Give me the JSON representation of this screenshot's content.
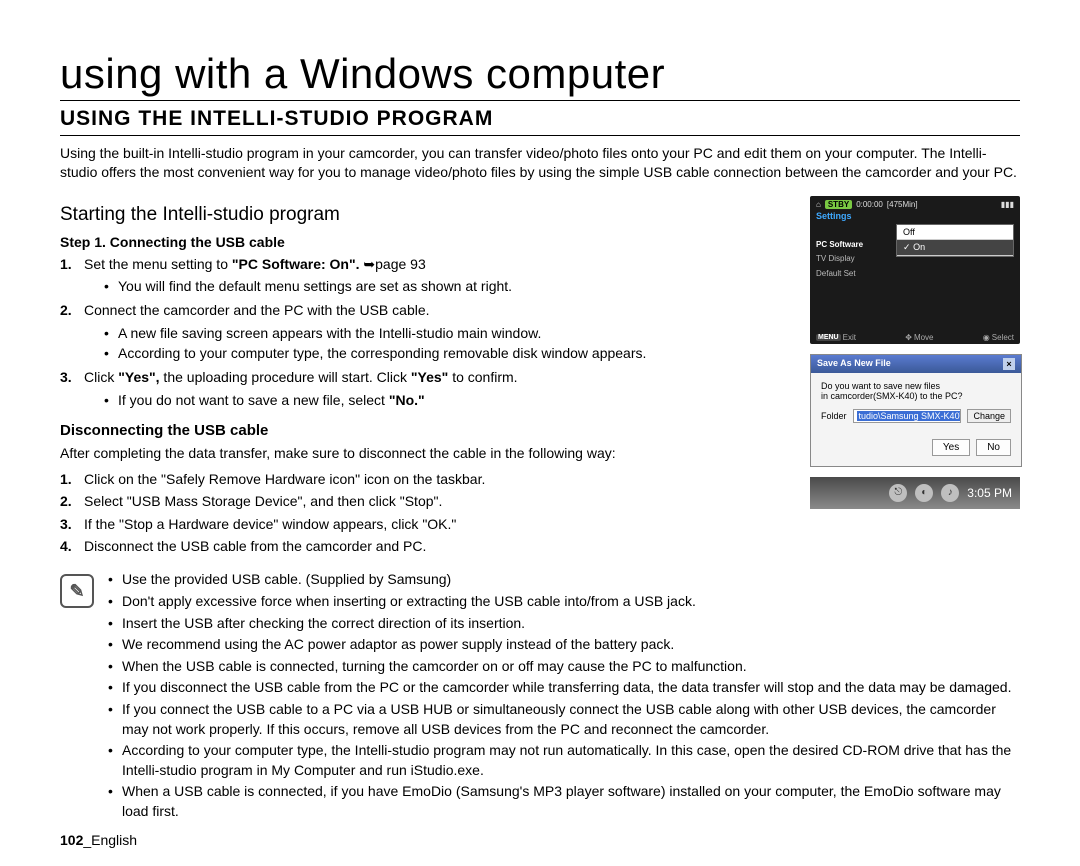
{
  "chapter_title": "using with a Windows computer",
  "section_title": "USING THE INTELLI-STUDIO PROGRAM",
  "intro": "Using the built-in Intelli-studio program in your camcorder, you can transfer video/photo files onto your PC and edit them on your computer. The Intelli-studio offers the most convenient way for you to manage video/photo files by using the simple USB cable connection between the camcorder and your PC.",
  "subhead": "Starting the Intelli-studio program",
  "step1_title": "Step 1. Connecting the USB cable",
  "step1_1_pre": "Set the menu setting to ",
  "step1_1_bold": "\"PC Software: On\". ",
  "step1_1_post": "page 93",
  "step1_1_sub1": "You will find the default menu settings are set as shown at right.",
  "step1_2": "Connect the camcorder and the PC with the USB cable.",
  "step1_2_sub1": "A new file saving screen appears with the Intelli-studio main window.",
  "step1_2_sub2": "According to your computer type, the corresponding removable disk window appears.",
  "step1_3_pre": "Click ",
  "step1_3_b1": "\"Yes\",",
  "step1_3_mid": " the uploading procedure will start. Click ",
  "step1_3_b2": "\"Yes\"",
  "step1_3_post": " to confirm.",
  "step1_3_sub1_pre": "If you do not want to save a new file, select ",
  "step1_3_sub1_b": "\"No.\"",
  "disc_title": "Disconnecting the USB cable",
  "disc_intro": "After completing the data transfer, make sure to disconnect the cable in the following way:",
  "disc_1": "Click on the \"Safely Remove Hardware icon\" icon on the taskbar.",
  "disc_2": "Select \"USB Mass Storage Device\", and then click \"Stop\".",
  "disc_3": "If the \"Stop a Hardware device\" window appears, click \"OK.\"",
  "disc_4": "Disconnect the USB cable from the camcorder and PC.",
  "notes": {
    "n1": "Use the provided USB cable. (Supplied by Samsung)",
    "n2": "Don't apply excessive force when inserting or extracting the USB cable into/from a USB jack.",
    "n3": "Insert the USB after checking the correct direction of its insertion.",
    "n4": "We recommend using the AC power adaptor as power supply instead of the battery pack.",
    "n5": "When the USB cable is connected, turning the camcorder on or off may cause the PC to malfunction.",
    "n6": "If you disconnect the USB cable from the PC or the camcorder while transferring data, the data transfer will stop and the data may be damaged.",
    "n7": "If you connect the USB cable to a PC via a USB HUB or simultaneously connect the USB cable along with other USB devices, the camcorder may not work properly. If this occurs, remove all USB devices from the PC and reconnect the camcorder.",
    "n8": "According to your computer type, the Intelli-studio program may not run automatically. In this case, open the desired CD-ROM drive that has the Intelli-studio program in My Computer and run iStudio.exe.",
    "n9": "When a USB cable is connected, if you have EmoDio (Samsung's MP3 player software) installed on your computer, the EmoDio software may load first."
  },
  "lcd": {
    "stby": "STBY",
    "time": "0:00:00",
    "remain": "[475Min]",
    "settings": "Settings",
    "left_items": [
      "PC Software",
      "TV Display",
      "Default Set"
    ],
    "menu_off": "Off",
    "menu_on": "On",
    "menu_check": "✓",
    "bar_menu": "MENU",
    "bar_exit": "Exit",
    "bar_move": "Move",
    "bar_select": "Select"
  },
  "dialog": {
    "title": "Save As New File",
    "line1": "Do you want to save new files",
    "line2": "in camcorder(SMX-K40) to the PC?",
    "folder_label": "Folder",
    "path_hl": "tudio\\Samsung SMX-K40\\",
    "change": "Change",
    "yes": "Yes",
    "no": "No"
  },
  "taskbar": {
    "time": "3:05 PM"
  },
  "footer": {
    "page_no": "102",
    "lang": "_English"
  }
}
